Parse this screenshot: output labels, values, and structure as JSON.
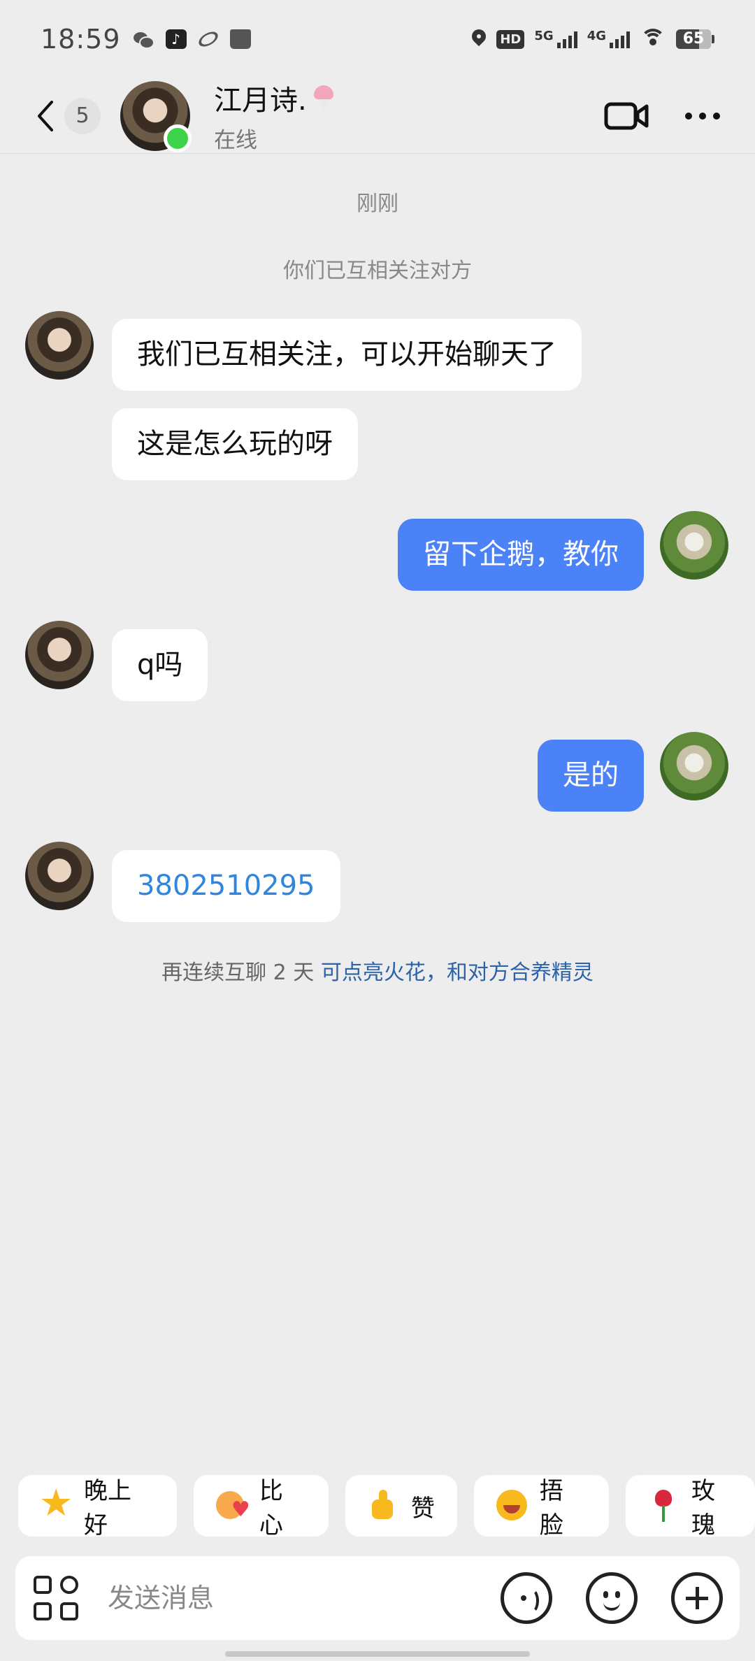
{
  "status_bar": {
    "time": "18:59",
    "app_icons": [
      "wechat-icon",
      "tiktok-icon",
      "swirl-app-icon",
      "book-app-icon"
    ],
    "hd_label": "HD",
    "signal_1_label": "5G",
    "signal_2_label": "4G",
    "battery_level": "65"
  },
  "header": {
    "unread_count": "5",
    "contact_name": "江月诗.",
    "contact_status": "在线",
    "online_color": "#3dd34a"
  },
  "chat": {
    "time_label": "刚刚",
    "follow_notice": "你们已互相关注对方",
    "messages": [
      {
        "side": "in",
        "text": "我们已互相关注，可以开始聊天了"
      },
      {
        "side": "in",
        "text": "这是怎么玩的呀"
      },
      {
        "side": "out",
        "text": "留下企鹅，教你"
      },
      {
        "side": "in",
        "text": "q吗"
      },
      {
        "side": "out",
        "text": "是的"
      },
      {
        "side": "in",
        "text": "3802510295"
      }
    ],
    "streak_tip": "再连续互聊 2 天 ",
    "streak_link": "可点亮火花，和对方合养精灵"
  },
  "quick_replies": [
    {
      "icon": "star-icon",
      "label": "晚上好"
    },
    {
      "icon": "heart-hands-icon",
      "label": "比心"
    },
    {
      "icon": "thumbs-up-icon",
      "label": "赞"
    },
    {
      "icon": "laugh-cover-face-icon",
      "label": "捂脸"
    },
    {
      "icon": "rose-icon",
      "label": "玫瑰"
    }
  ],
  "input": {
    "placeholder": "发送消息",
    "value": ""
  },
  "colors": {
    "outgoing_bubble": "#4b82f7",
    "incoming_bubble": "#ffffff",
    "link": "#2b62a8",
    "phone_number": "#2e86de"
  }
}
